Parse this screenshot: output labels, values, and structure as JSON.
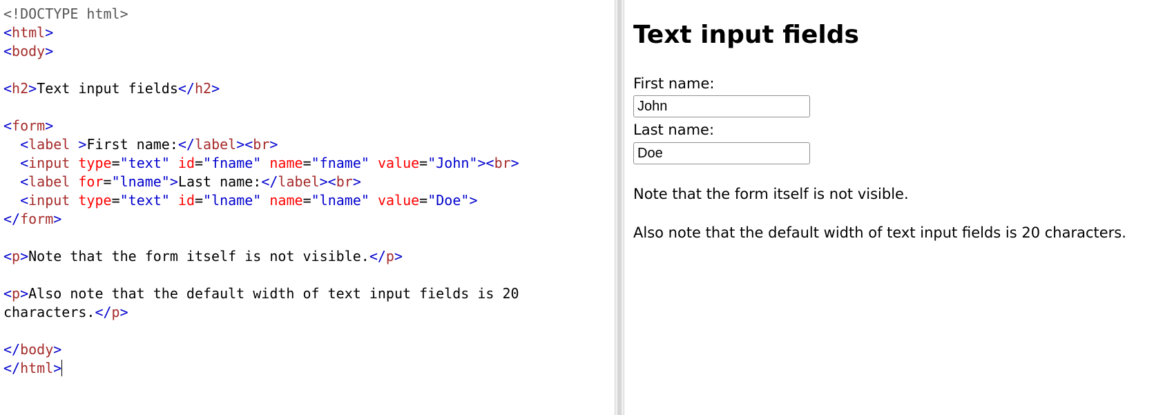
{
  "editor": {
    "lines": [
      [
        {
          "c": "doctype",
          "t": "<!DOCTYPE html>"
        }
      ],
      [
        {
          "c": "br",
          "t": "<"
        },
        {
          "c": "tag",
          "t": "html"
        },
        {
          "c": "br",
          "t": ">"
        }
      ],
      [
        {
          "c": "br",
          "t": "<"
        },
        {
          "c": "tag",
          "t": "body"
        },
        {
          "c": "br",
          "t": ">"
        }
      ],
      [],
      [
        {
          "c": "br",
          "t": "<"
        },
        {
          "c": "tag",
          "t": "h2"
        },
        {
          "c": "br",
          "t": ">"
        },
        {
          "c": "txt",
          "t": "Text input fields"
        },
        {
          "c": "br",
          "t": "</"
        },
        {
          "c": "tag",
          "t": "h2"
        },
        {
          "c": "br",
          "t": ">"
        }
      ],
      [],
      [
        {
          "c": "br",
          "t": "<"
        },
        {
          "c": "tag",
          "t": "form"
        },
        {
          "c": "br",
          "t": ">"
        }
      ],
      [
        {
          "c": "txt",
          "t": "  "
        },
        {
          "c": "br",
          "t": "<"
        },
        {
          "c": "tag",
          "t": "label "
        },
        {
          "c": "br",
          "t": ">"
        },
        {
          "c": "txt",
          "t": "First name:"
        },
        {
          "c": "br",
          "t": "</"
        },
        {
          "c": "tag",
          "t": "label"
        },
        {
          "c": "br",
          "t": "><"
        },
        {
          "c": "tag",
          "t": "br"
        },
        {
          "c": "br",
          "t": ">"
        }
      ],
      [
        {
          "c": "txt",
          "t": "  "
        },
        {
          "c": "br",
          "t": "<"
        },
        {
          "c": "tag",
          "t": "input "
        },
        {
          "c": "attr",
          "t": "type"
        },
        {
          "c": "txt",
          "t": "="
        },
        {
          "c": "val",
          "t": "\"text\""
        },
        {
          "c": "txt",
          "t": " "
        },
        {
          "c": "attr",
          "t": "id"
        },
        {
          "c": "txt",
          "t": "="
        },
        {
          "c": "val",
          "t": "\"fname\""
        },
        {
          "c": "txt",
          "t": " "
        },
        {
          "c": "attr",
          "t": "name"
        },
        {
          "c": "txt",
          "t": "="
        },
        {
          "c": "val",
          "t": "\"fname\""
        },
        {
          "c": "txt",
          "t": " "
        },
        {
          "c": "attr",
          "t": "value"
        },
        {
          "c": "txt",
          "t": "="
        },
        {
          "c": "val",
          "t": "\"John\""
        },
        {
          "c": "br",
          "t": "><"
        },
        {
          "c": "tag",
          "t": "br"
        },
        {
          "c": "br",
          "t": ">"
        }
      ],
      [
        {
          "c": "txt",
          "t": "  "
        },
        {
          "c": "br",
          "t": "<"
        },
        {
          "c": "tag",
          "t": "label "
        },
        {
          "c": "attr",
          "t": "for"
        },
        {
          "c": "txt",
          "t": "="
        },
        {
          "c": "val",
          "t": "\"lname\""
        },
        {
          "c": "br",
          "t": ">"
        },
        {
          "c": "txt",
          "t": "Last name:"
        },
        {
          "c": "br",
          "t": "</"
        },
        {
          "c": "tag",
          "t": "label"
        },
        {
          "c": "br",
          "t": "><"
        },
        {
          "c": "tag",
          "t": "br"
        },
        {
          "c": "br",
          "t": ">"
        }
      ],
      [
        {
          "c": "txt",
          "t": "  "
        },
        {
          "c": "br",
          "t": "<"
        },
        {
          "c": "tag",
          "t": "input "
        },
        {
          "c": "attr",
          "t": "type"
        },
        {
          "c": "txt",
          "t": "="
        },
        {
          "c": "val",
          "t": "\"text\""
        },
        {
          "c": "txt",
          "t": " "
        },
        {
          "c": "attr",
          "t": "id"
        },
        {
          "c": "txt",
          "t": "="
        },
        {
          "c": "val",
          "t": "\"lname\""
        },
        {
          "c": "txt",
          "t": " "
        },
        {
          "c": "attr",
          "t": "name"
        },
        {
          "c": "txt",
          "t": "="
        },
        {
          "c": "val",
          "t": "\"lname\""
        },
        {
          "c": "txt",
          "t": " "
        },
        {
          "c": "attr",
          "t": "value"
        },
        {
          "c": "txt",
          "t": "="
        },
        {
          "c": "val",
          "t": "\"Doe\""
        },
        {
          "c": "br",
          "t": ">"
        }
      ],
      [
        {
          "c": "br",
          "t": "</"
        },
        {
          "c": "tag",
          "t": "form"
        },
        {
          "c": "br",
          "t": ">"
        }
      ],
      [],
      [
        {
          "c": "br",
          "t": "<"
        },
        {
          "c": "tag",
          "t": "p"
        },
        {
          "c": "br",
          "t": ">"
        },
        {
          "c": "txt",
          "t": "Note that the form itself is not visible."
        },
        {
          "c": "br",
          "t": "</"
        },
        {
          "c": "tag",
          "t": "p"
        },
        {
          "c": "br",
          "t": ">"
        }
      ],
      [],
      [
        {
          "c": "br",
          "t": "<"
        },
        {
          "c": "tag",
          "t": "p"
        },
        {
          "c": "br",
          "t": ">"
        },
        {
          "c": "txt",
          "t": "Also note that the default width of text input fields is 20"
        }
      ],
      [
        {
          "c": "txt",
          "t": "characters."
        },
        {
          "c": "br",
          "t": "</"
        },
        {
          "c": "tag",
          "t": "p"
        },
        {
          "c": "br",
          "t": ">"
        }
      ],
      [],
      [
        {
          "c": "br",
          "t": "</"
        },
        {
          "c": "tag",
          "t": "body"
        },
        {
          "c": "br",
          "t": ">"
        }
      ],
      [
        {
          "c": "br",
          "t": "</"
        },
        {
          "c": "tag",
          "t": "html"
        },
        {
          "c": "br",
          "t": ">"
        }
      ]
    ]
  },
  "result": {
    "heading": "Text input fields",
    "first_name_label": "First name:",
    "first_name_value": "John",
    "last_name_label": "Last name:",
    "last_name_value": "Doe",
    "note1": "Note that the form itself is not visible.",
    "note2": "Also note that the default width of text input fields is 20 characters."
  }
}
